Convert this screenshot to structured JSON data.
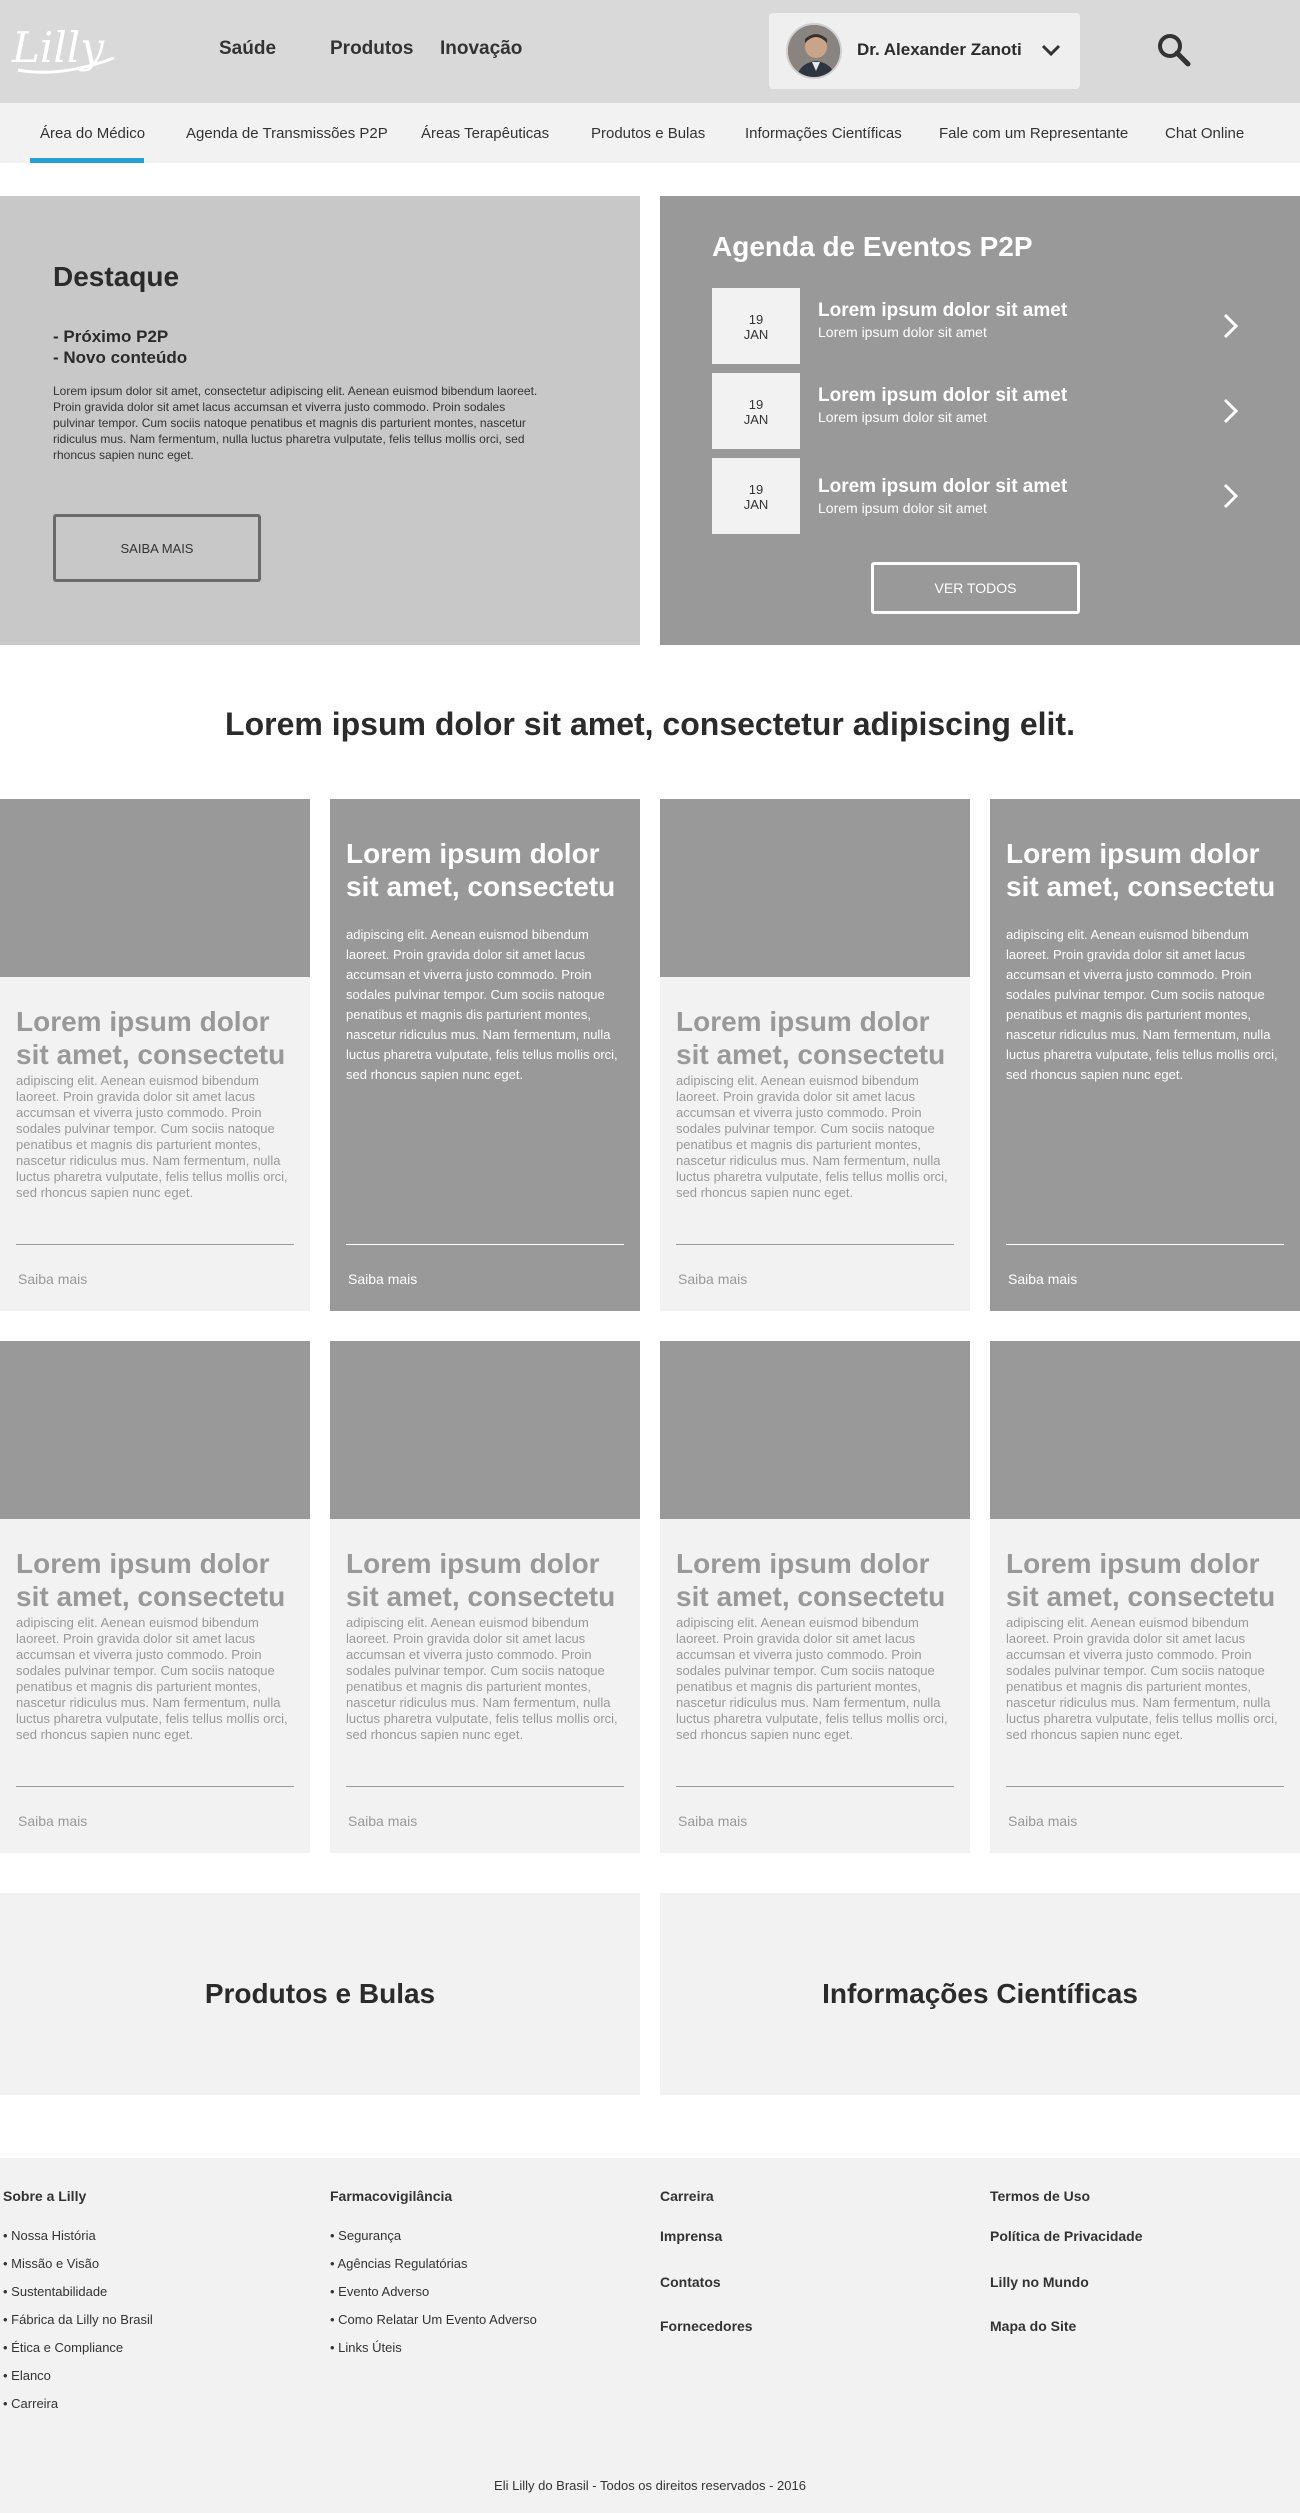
{
  "header": {
    "logo_text": "Lilly",
    "nav": [
      "Saúde",
      "Produtos",
      "Inovação"
    ],
    "user_name": "Dr. Alexander Zanoti"
  },
  "subnav": [
    "Área do Médico",
    "Agenda de Transmissões P2P",
    "Áreas Terapêuticas",
    "Produtos e Bulas",
    "Informações Científicas",
    "Fale com um Representante",
    "Chat Online"
  ],
  "hero": {
    "title": "Destaque",
    "list": [
      "- Próximo P2P",
      "- Novo conteúdo"
    ],
    "body": "Lorem ipsum dolor sit amet, consectetur adipiscing elit. Aenean euismod bibendum laoreet. Proin gravida dolor sit amet lacus accumsan et viverra justo commodo. Proin sodales pulvinar tempor. Cum sociis natoque penatibus et magnis dis parturient montes, nascetur ridiculus mus. Nam fermentum, nulla luctus pharetra vulputate, felis tellus mollis orci, sed rhoncus sapien nunc eget.",
    "button": "SAIBA MAIS"
  },
  "events": {
    "title": "Agenda de Eventos P2P",
    "items": [
      {
        "day": "19",
        "month": "JAN",
        "title": "Lorem ipsum dolor sit amet",
        "sub": "Lorem ipsum dolor sit amet"
      },
      {
        "day": "19",
        "month": "JAN",
        "title": "Lorem ipsum dolor sit amet",
        "sub": "Lorem ipsum dolor sit amet"
      },
      {
        "day": "19",
        "month": "JAN",
        "title": "Lorem ipsum dolor sit amet",
        "sub": "Lorem ipsum dolor sit amet"
      }
    ],
    "button": "VER TODOS"
  },
  "headline": "Lorem ipsum dolor sit amet, consectetur adipiscing elit.",
  "cards": {
    "title": "Lorem ipsum dolor sit amet, consectetu",
    "body": "adipiscing elit. Aenean euismod bibendum laoreet. Proin gravida dolor sit amet lacus accumsan et viverra justo commodo. Proin sodales pulvinar tempor. Cum sociis natoque penatibus et magnis dis parturient montes, nascetur ridiculus mus. Nam fermentum, nulla luctus pharetra vulputate, felis tellus mollis orci, sed rhoncus sapien nunc eget.",
    "link": "Saiba mais"
  },
  "promos": [
    "Produtos e Bulas",
    "Informações Científicas"
  ],
  "footer": {
    "col1": {
      "title": "Sobre a Lilly",
      "items": [
        "• Nossa História",
        "• Missão e Visão",
        "• Sustentabilidade",
        "• Fábrica da Lilly no Brasil",
        "• Ética e Compliance",
        "• Elanco",
        "• Carreira"
      ]
    },
    "col2": {
      "title": "Farmacovigilância",
      "items": [
        "• Segurança",
        "• Agências Regulatórias",
        "• Evento Adverso",
        "• Como Relatar Um Evento Adverso",
        "• Links Úteis"
      ]
    },
    "col3": [
      "Carreira",
      "Imprensa",
      "Contatos",
      "Fornecedores"
    ],
    "col4": [
      "Termos de Uso",
      "Política de Privacidade",
      "Lilly no Mundo",
      "Mapa do Site"
    ],
    "copyright": "Eli Lilly do Brasil - Todos os direitos reservados - 2016"
  }
}
